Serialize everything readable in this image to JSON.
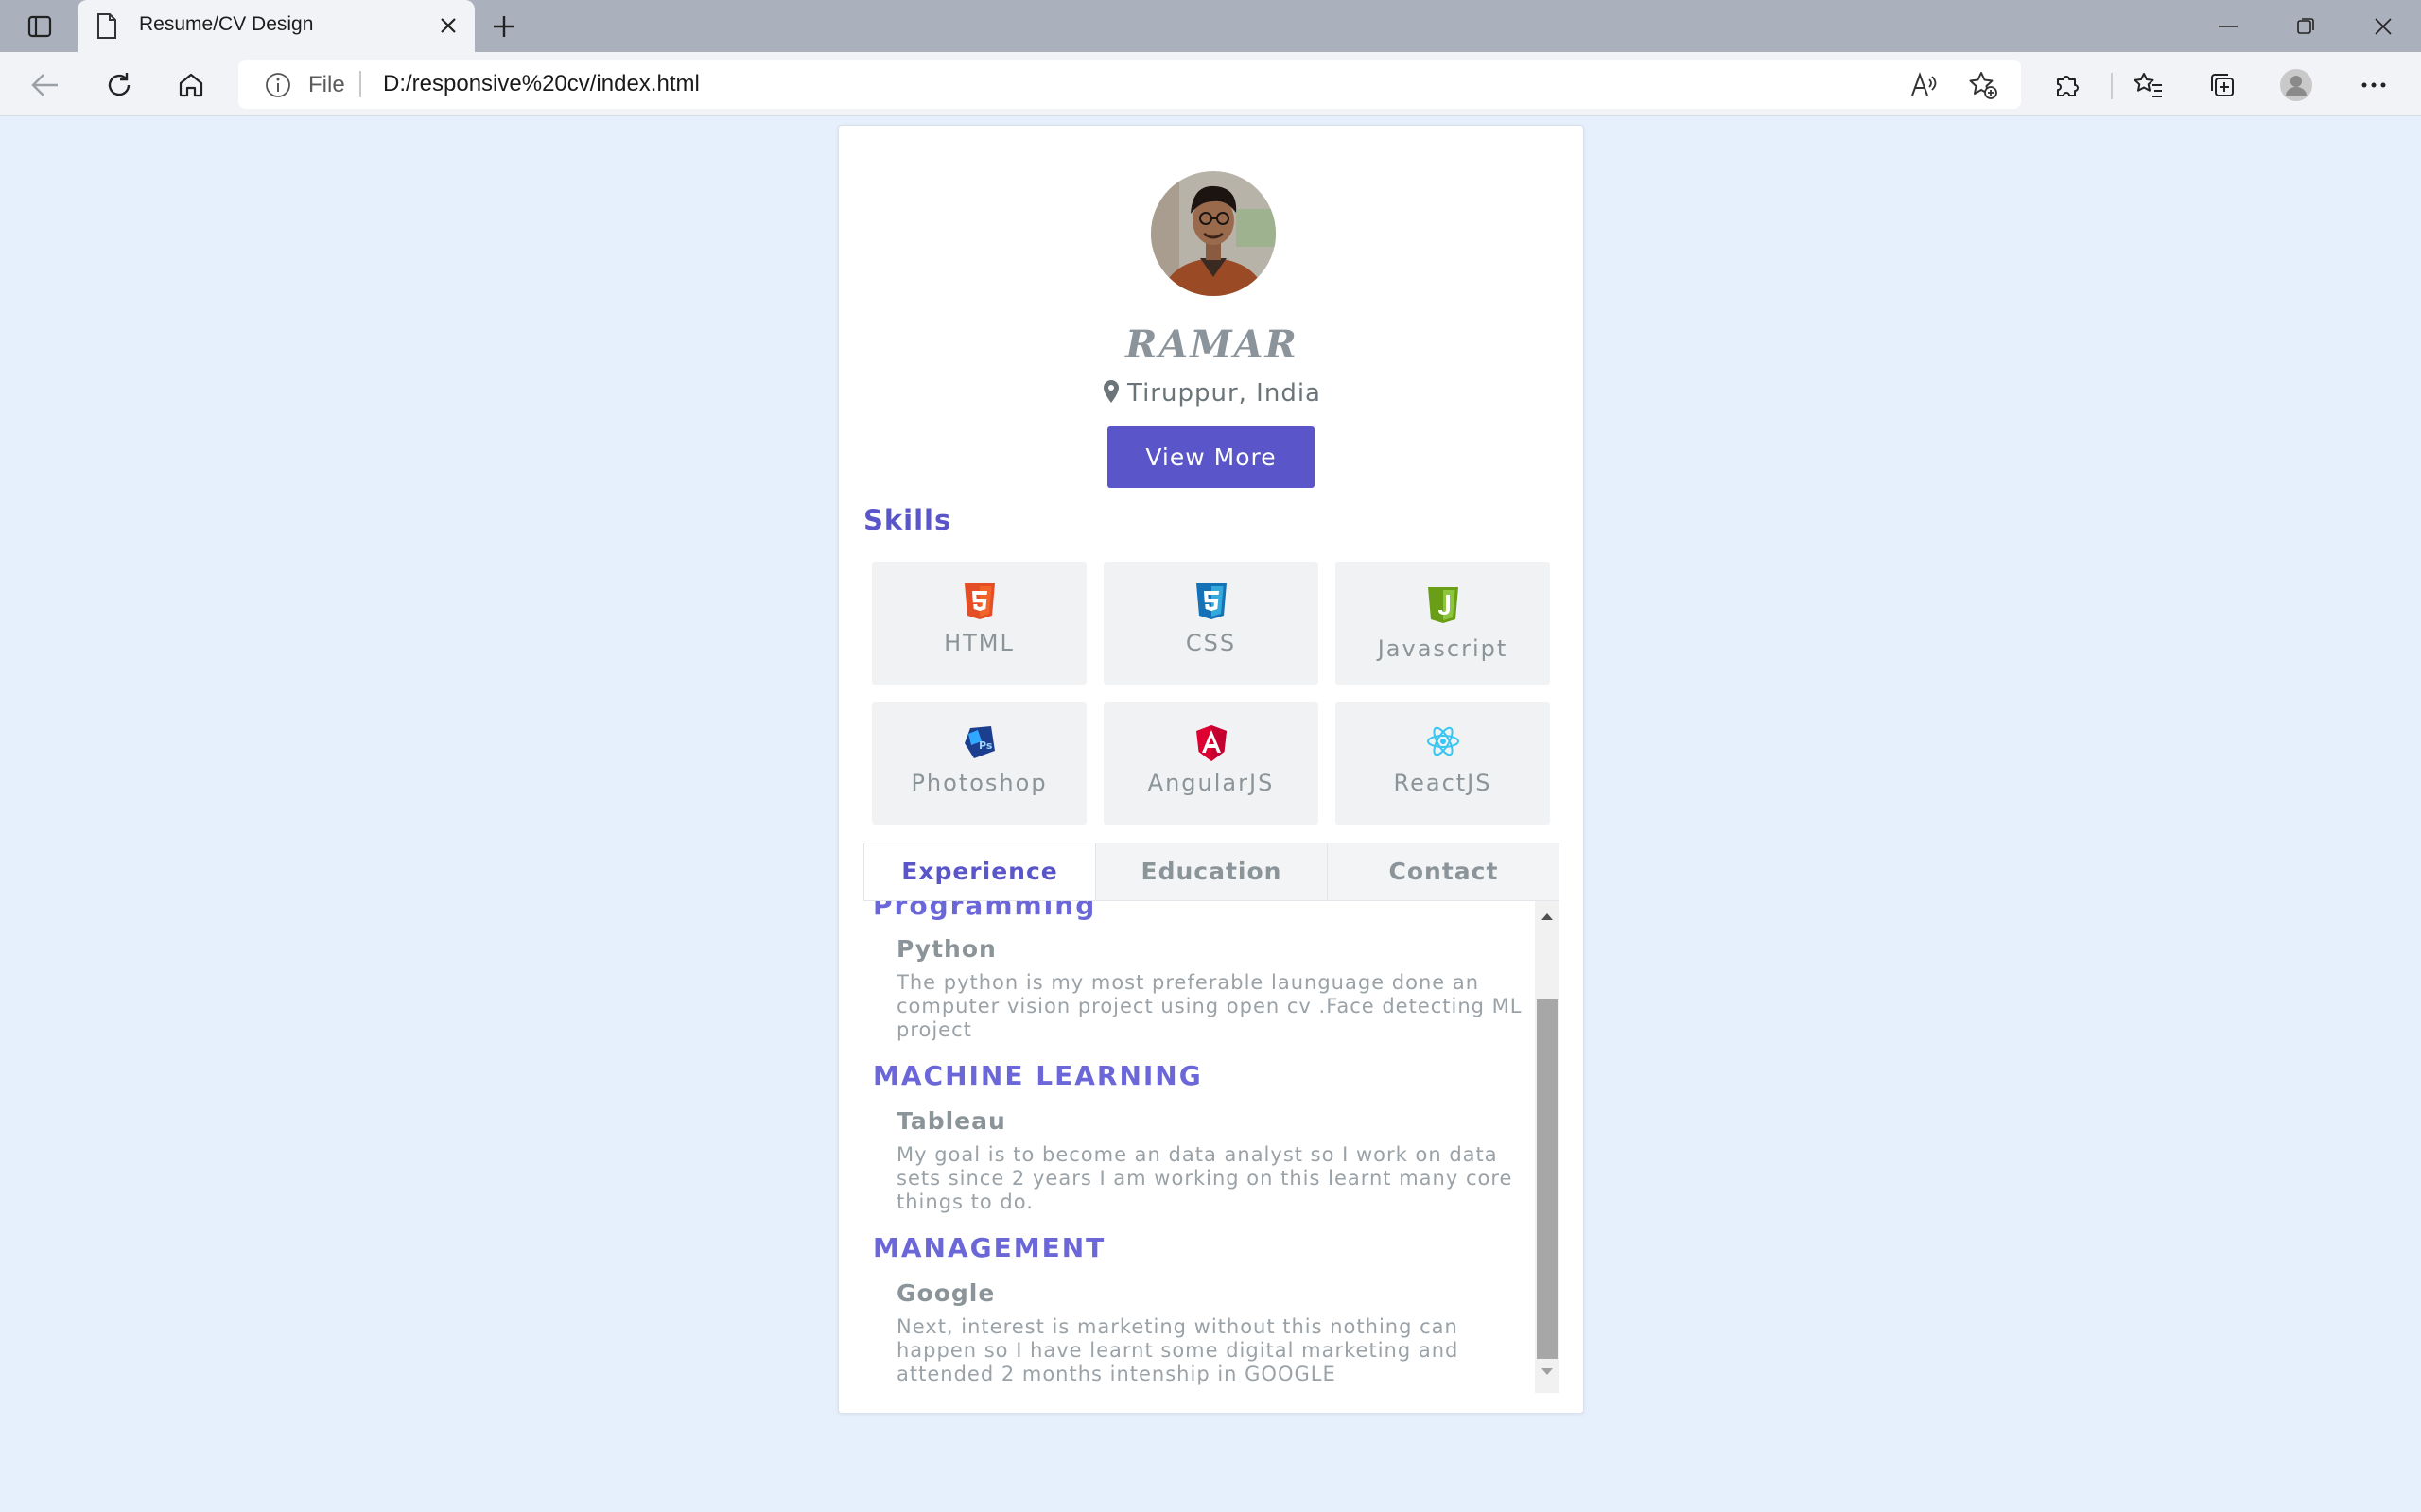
{
  "browser": {
    "tab_title": "Resume/CV Design",
    "address_prefix": "File",
    "url": "D:/responsive%20cv/index.html"
  },
  "profile": {
    "name": "RAMAR",
    "location": "Tiruppur, India",
    "view_more_label": "View More"
  },
  "skills": {
    "title": "Skills",
    "items": [
      {
        "label": "HTML",
        "icon": "html5-icon",
        "color": "#e44d26"
      },
      {
        "label": "CSS",
        "icon": "css3-icon",
        "color": "#1f7bc1"
      },
      {
        "label": "Javascript",
        "icon": "js-icon",
        "color": "#7cb518"
      },
      {
        "label": "Photoshop",
        "icon": "photoshop-icon",
        "color": "#1c3e8e"
      },
      {
        "label": "AngularJS",
        "icon": "angular-icon",
        "color": "#dd1b16"
      },
      {
        "label": "ReactJS",
        "icon": "react-icon",
        "color": "#35c7f2"
      }
    ]
  },
  "tabs": [
    {
      "label": "Experience",
      "active": true
    },
    {
      "label": "Education",
      "active": false
    },
    {
      "label": "Contact",
      "active": false
    }
  ],
  "experience": [
    {
      "category": "Programming",
      "title": "Python",
      "description": "The python is my most preferable launguage done an computer vision project using open cv .Face detecting ML project"
    },
    {
      "category": "MACHINE LEARNING",
      "title": "Tableau",
      "description": "My goal is to become an data analyst so I work on data sets since 2 years I am working on this learnt many core things to do."
    },
    {
      "category": "MANAGEMENT",
      "title": "Google",
      "description": "Next, interest is marketing without this nothing can happen so I have learnt some digital marketing and attended 2 months intenship in GOOGLE"
    }
  ],
  "colors": {
    "accent": "#5a56c9",
    "page_background": "#e6effc"
  }
}
